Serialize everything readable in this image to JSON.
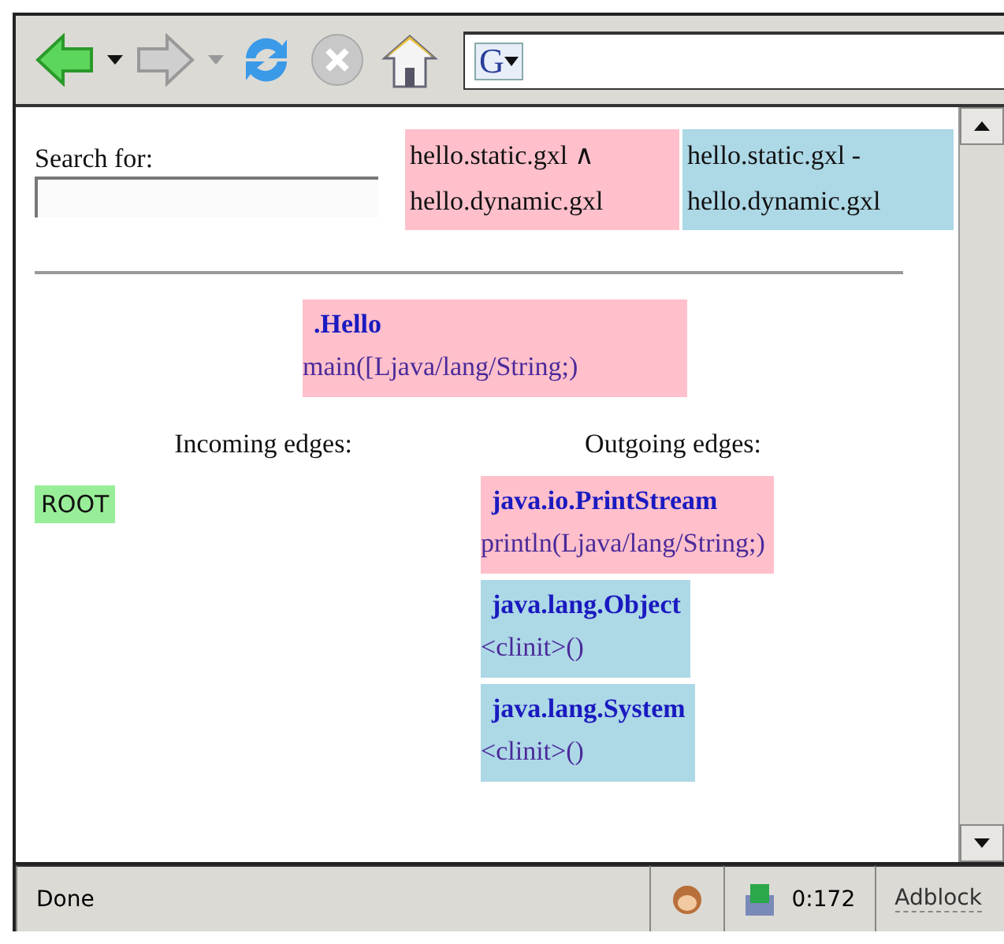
{
  "toolbar": {
    "buttons": [
      {
        "kind": "back",
        "disabled": false
      },
      {
        "kind": "back-menu",
        "disabled": false
      },
      {
        "kind": "forward",
        "disabled": true
      },
      {
        "kind": "forward-menu",
        "disabled": true
      },
      {
        "kind": "reload",
        "disabled": false
      },
      {
        "kind": "stop",
        "disabled": true
      },
      {
        "kind": "home",
        "disabled": false
      }
    ],
    "search_engine_letter": "G"
  },
  "search": {
    "label": "Search for:"
  },
  "diff_legend": [
    {
      "text": "hello.static.gxl ∧ hello.dynamic.gxl",
      "color": "#ffc0cb"
    },
    {
      "text": "hello.static.gxl - hello.dynamic.gxl",
      "color": "#add8e6"
    }
  ],
  "node": {
    "class": ".Hello",
    "method": "main([Ljava/lang/String;)",
    "color": "#ffc0cb"
  },
  "incoming": {
    "heading": "Incoming edges:",
    "items": [
      {
        "class": "ROOT",
        "color": "#98ee98"
      }
    ]
  },
  "outgoing": {
    "heading": "Outgoing edges:",
    "items": [
      {
        "class": "java.io.PrintStream",
        "method": "println(Ljava/lang/String;)",
        "color": "#ffc0cb"
      },
      {
        "class": "java.lang.Object",
        "method": "<clinit>()",
        "color": "#add8e6"
      },
      {
        "class": "java.lang.System",
        "method": "<clinit>()",
        "color": "#add8e6"
      }
    ]
  },
  "status_bar": {
    "message": "Done",
    "timer": "0:172",
    "adblock": "Adblock"
  }
}
